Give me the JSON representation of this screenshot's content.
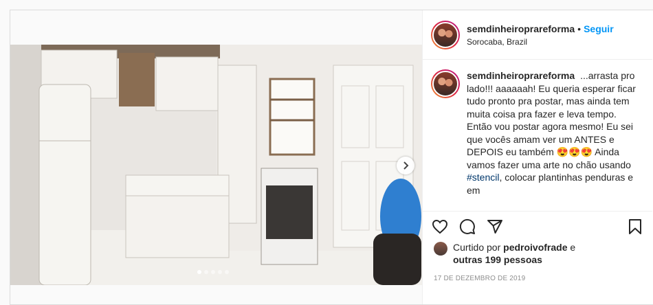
{
  "post": {
    "username": "semdinheiroprareforma",
    "separator": "•",
    "follow_label": "Seguir",
    "location": "Sorocaba, Brazil",
    "caption_parts": {
      "text_before_hashtag": "...arrasta pro lado!!! aaaaaah! Eu queria esperar ficar tudo pronto pra postar, mas ainda tem muita coisa pra fazer e leva tempo. Então vou postar agora mesmo! Eu sei que vocês amam ver um ANTES e DEPOIS eu também 😍😍😍 Ainda vamos fazer uma arte no chão usando",
      "hashtag": "#stencil",
      "text_after_hashtag": ", colocar plantinhas penduras e em"
    },
    "likes": {
      "prefix": "Curtido por",
      "user": "pedroivofrade",
      "conjunction": "e",
      "others": "outras 199 pessoas"
    },
    "date": "17 DE DEZEMBRO DE 2019",
    "carousel": {
      "count": 5,
      "active_index": 0
    }
  },
  "icons": {
    "like": "heart-icon",
    "comment": "comment-icon",
    "share": "share-icon",
    "save": "bookmark-icon",
    "next": "chevron-right-icon"
  },
  "colors": {
    "follow": "#0095f6",
    "hashtag": "#00376b",
    "date": "#8e8e8e",
    "border": "#dbdbdb"
  }
}
